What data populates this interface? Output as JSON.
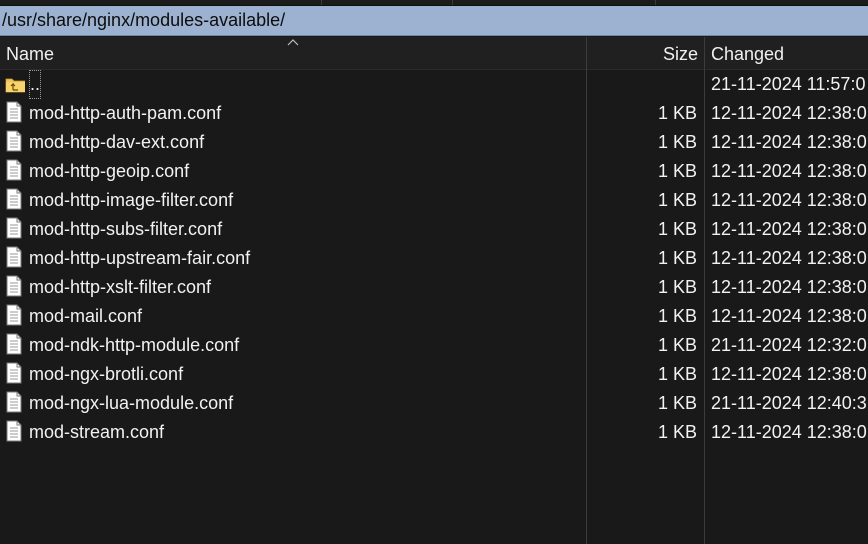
{
  "path": "/usr/share/nginx/modules-available/",
  "columns": {
    "name": "Name",
    "size": "Size",
    "changed": "Changed"
  },
  "parent": {
    "name": "..",
    "changed": "21-11-2024 11:57:0",
    "icon": "parent-folder-icon"
  },
  "files": [
    {
      "name": "mod-http-auth-pam.conf",
      "size": "1 KB",
      "changed": "12-11-2024 12:38:0",
      "icon": "file-icon"
    },
    {
      "name": "mod-http-dav-ext.conf",
      "size": "1 KB",
      "changed": "12-11-2024 12:38:0",
      "icon": "file-icon"
    },
    {
      "name": "mod-http-geoip.conf",
      "size": "1 KB",
      "changed": "12-11-2024 12:38:0",
      "icon": "file-icon"
    },
    {
      "name": "mod-http-image-filter.conf",
      "size": "1 KB",
      "changed": "12-11-2024 12:38:0",
      "icon": "file-icon"
    },
    {
      "name": "mod-http-subs-filter.conf",
      "size": "1 KB",
      "changed": "12-11-2024 12:38:0",
      "icon": "file-icon"
    },
    {
      "name": "mod-http-upstream-fair.conf",
      "size": "1 KB",
      "changed": "12-11-2024 12:38:0",
      "icon": "file-icon"
    },
    {
      "name": "mod-http-xslt-filter.conf",
      "size": "1 KB",
      "changed": "12-11-2024 12:38:0",
      "icon": "file-icon"
    },
    {
      "name": "mod-mail.conf",
      "size": "1 KB",
      "changed": "12-11-2024 12:38:0",
      "icon": "file-icon"
    },
    {
      "name": "mod-ndk-http-module.conf",
      "size": "1 KB",
      "changed": "21-11-2024 12:32:0",
      "icon": "file-icon"
    },
    {
      "name": "mod-ngx-brotli.conf",
      "size": "1 KB",
      "changed": "12-11-2024 12:38:0",
      "icon": "file-icon"
    },
    {
      "name": "mod-ngx-lua-module.conf",
      "size": "1 KB",
      "changed": "21-11-2024 12:40:3",
      "icon": "file-icon"
    },
    {
      "name": "mod-stream.conf",
      "size": "1 KB",
      "changed": "12-11-2024 12:38:0",
      "icon": "file-icon"
    }
  ],
  "colors": {
    "background": "#191919",
    "path_bar": "#9db2d0",
    "text": "#f2f2f2"
  }
}
